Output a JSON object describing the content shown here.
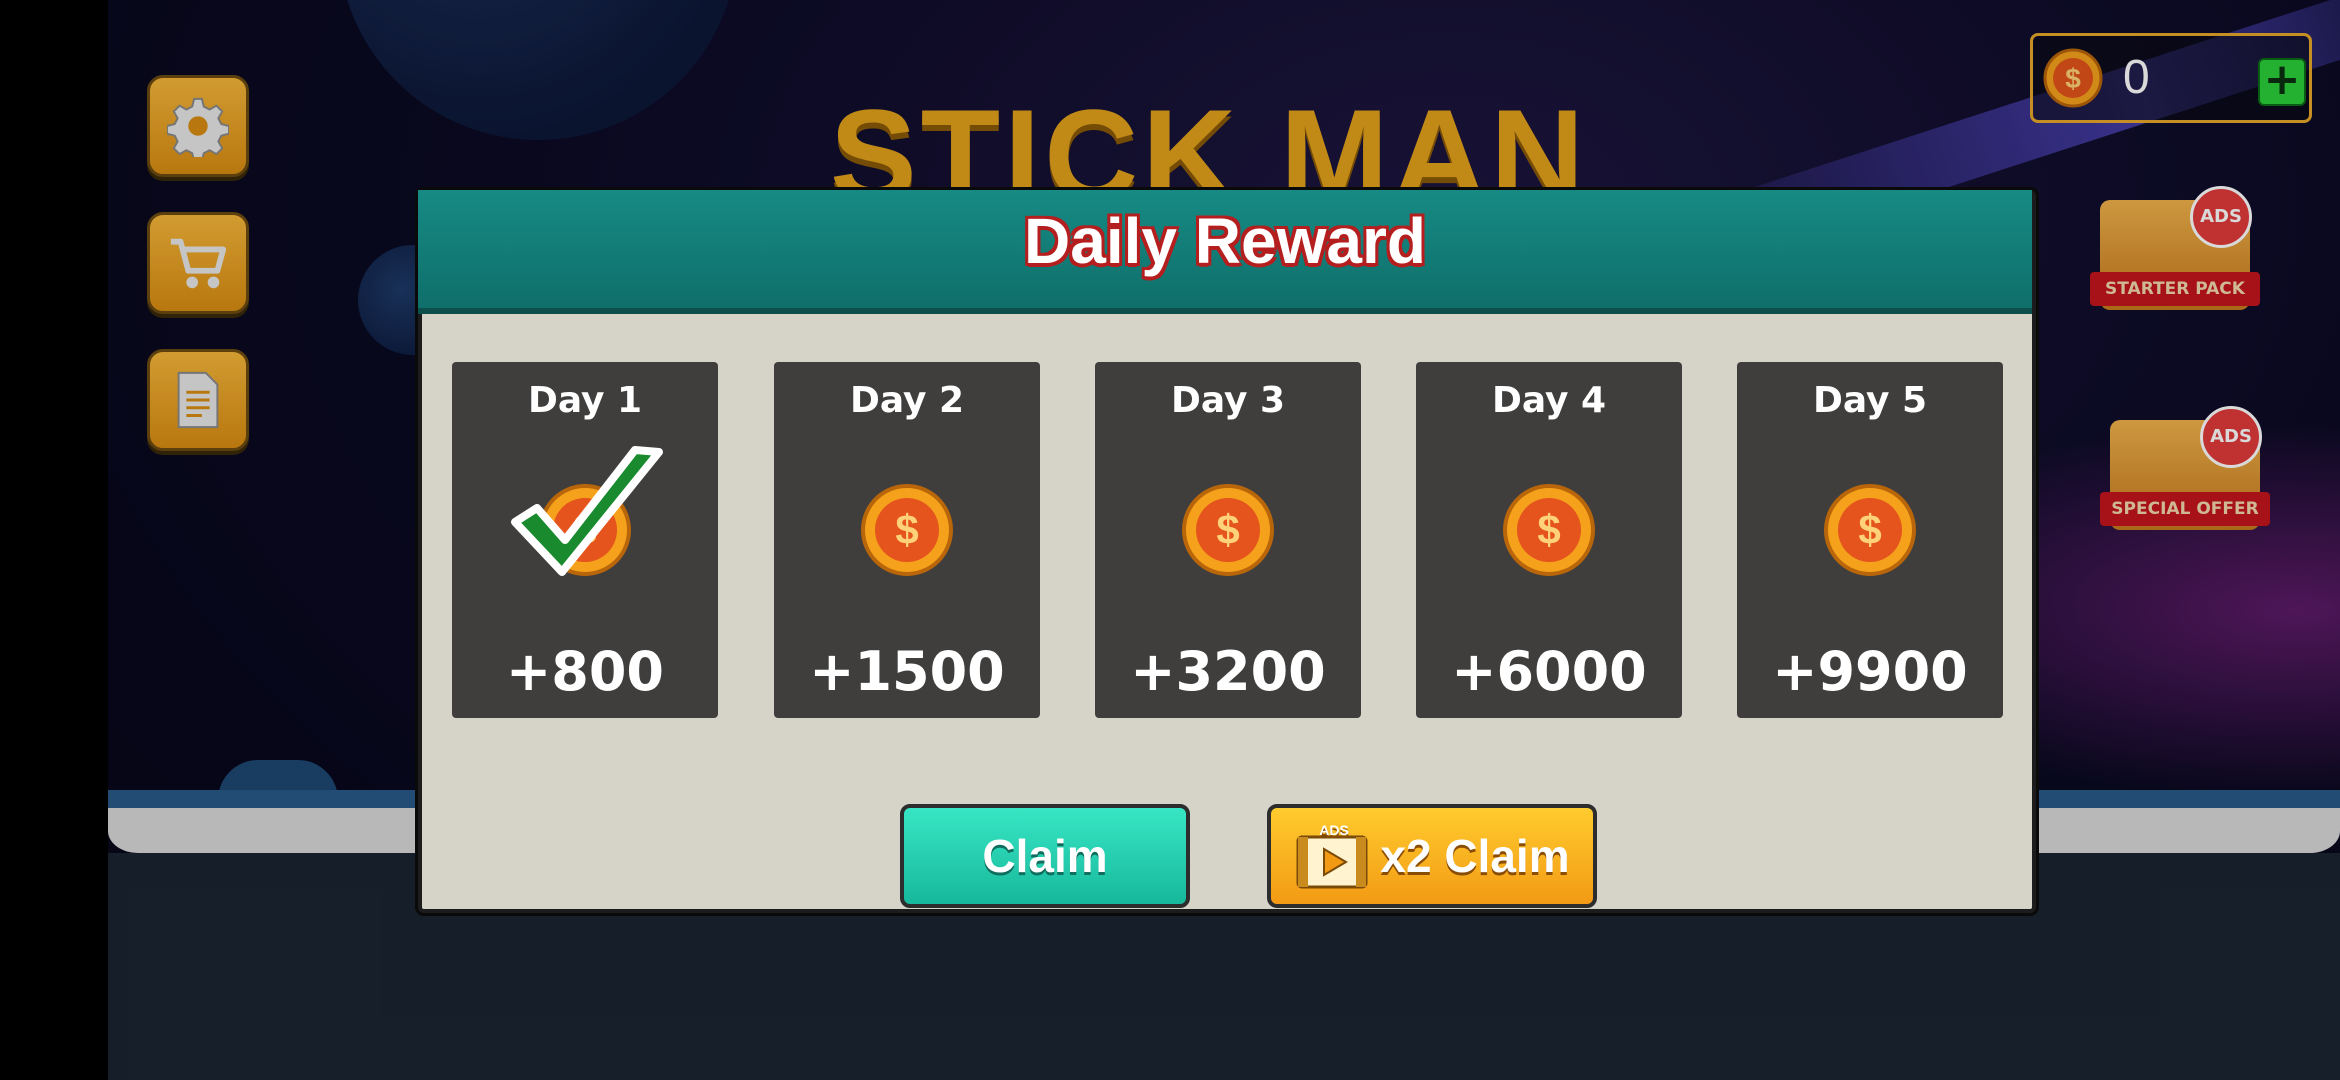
{
  "game": {
    "title_logo": "STICK MAN"
  },
  "hud": {
    "coin_count": "0"
  },
  "sidebar": {
    "buttons": [
      "settings",
      "shop",
      "missions"
    ]
  },
  "promos": {
    "starter_pack": {
      "ribbon": "STARTER PACK",
      "badge": "ADS"
    },
    "special_offer": {
      "ribbon": "SPECIAL OFFER",
      "badge": "ADS"
    }
  },
  "modal": {
    "title": "Daily Reward",
    "days": [
      {
        "label": "Day 1",
        "amount": "+800",
        "claimed": true
      },
      {
        "label": "Day 2",
        "amount": "+1500",
        "claimed": false
      },
      {
        "label": "Day 3",
        "amount": "+3200",
        "claimed": false
      },
      {
        "label": "Day 4",
        "amount": "+6000",
        "claimed": false
      },
      {
        "label": "Day 5",
        "amount": "+9900",
        "claimed": false
      }
    ],
    "claim_label": "Claim",
    "x2_claim_label": "x2 Claim",
    "ads_tag": "ADS"
  },
  "colors": {
    "header_teal": "#178a84",
    "claim_green": "#1fcfae",
    "x2_orange": "#f6b21e",
    "title_outline": "#b51e1e",
    "coin_orange": "#f39a14"
  }
}
